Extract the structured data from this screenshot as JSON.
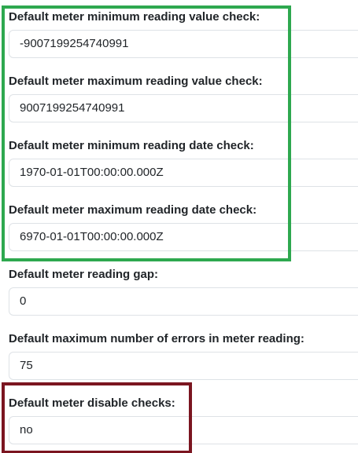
{
  "fields": [
    {
      "label": "Default meter minimum reading value check:",
      "value": "-9007199254740991"
    },
    {
      "label": "Default meter maximum reading value check:",
      "value": "9007199254740991"
    },
    {
      "label": "Default meter minimum reading date check:",
      "value": "1970-01-01T00:00:00.000Z"
    },
    {
      "label": "Default meter maximum reading date check:",
      "value": "6970-01-01T00:00:00.000Z"
    },
    {
      "label": "Default meter reading gap:",
      "value": "0"
    },
    {
      "label": "Default maximum number of errors in meter reading:",
      "value": "75"
    },
    {
      "label": "Default meter disable checks:",
      "value": "no"
    }
  ],
  "colors": {
    "group_highlight": "#2ea84f",
    "disable_checks_highlight": "#7b1520"
  }
}
